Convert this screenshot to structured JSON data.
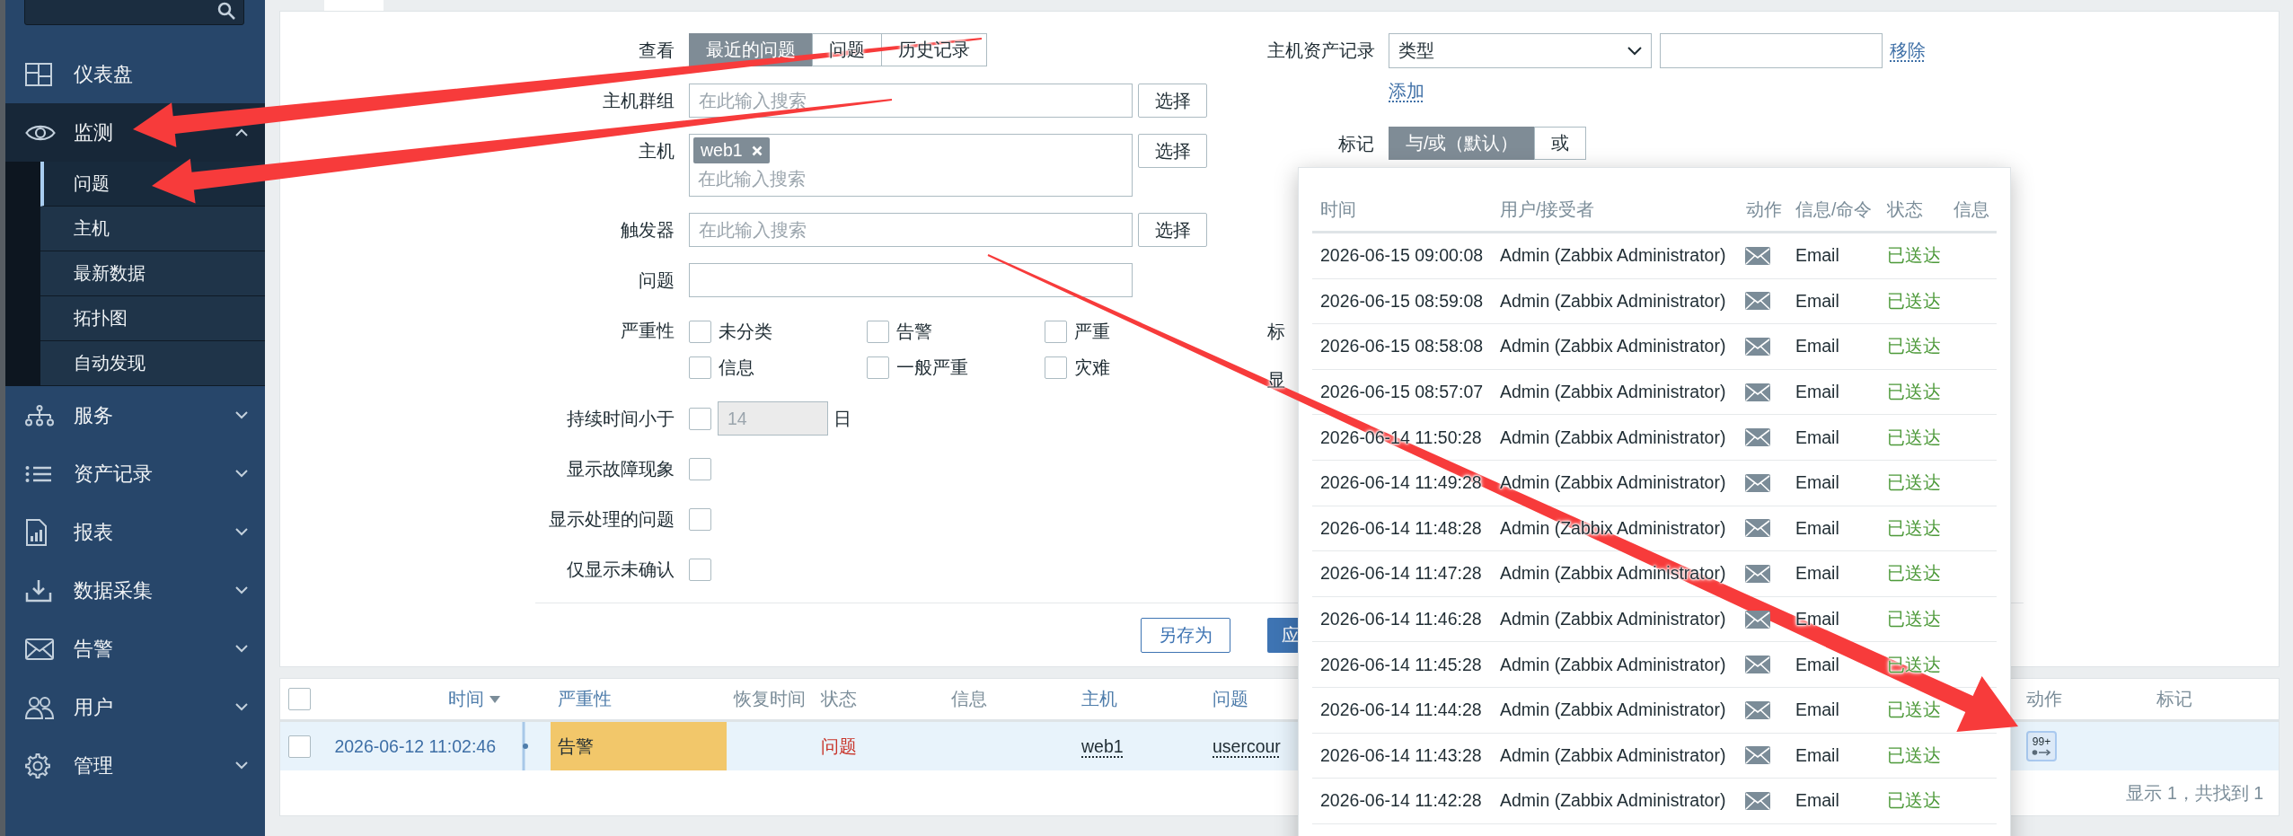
{
  "sidebar": {
    "items": [
      {
        "label": "仪表盘",
        "kind": "link"
      },
      {
        "label": "监测",
        "kind": "group",
        "expanded": true,
        "children": [
          {
            "label": "问题",
            "selected": true
          },
          {
            "label": "主机",
            "selected": false
          },
          {
            "label": "最新数据",
            "selected": false
          },
          {
            "label": "拓扑图",
            "selected": false
          },
          {
            "label": "自动发现",
            "selected": false
          }
        ]
      },
      {
        "label": "服务",
        "kind": "group",
        "expanded": false
      },
      {
        "label": "资产记录",
        "kind": "group",
        "expanded": false
      },
      {
        "label": "报表",
        "kind": "group",
        "expanded": false
      },
      {
        "label": "数据采集",
        "kind": "group",
        "expanded": false
      },
      {
        "label": "告警",
        "kind": "group",
        "expanded": false
      },
      {
        "label": "用户",
        "kind": "group",
        "expanded": false
      },
      {
        "label": "管理",
        "kind": "group",
        "expanded": false
      }
    ]
  },
  "filter": {
    "view": {
      "label": "查看",
      "options": [
        {
          "label": "最近的问题",
          "selected": true
        },
        {
          "label": "问题",
          "selected": false
        },
        {
          "label": "历史记录",
          "selected": false
        }
      ]
    },
    "host_groups": {
      "label": "主机群组",
      "placeholder": "在此输入搜索",
      "button": "选择"
    },
    "hosts": {
      "label": "主机",
      "tags": [
        "web1"
      ],
      "placeholder": "在此输入搜索",
      "button": "选择"
    },
    "triggers": {
      "label": "触发器",
      "placeholder": "在此输入搜索",
      "button": "选择"
    },
    "problem": {
      "label": "问题"
    },
    "severity": {
      "label": "严重性",
      "options": [
        {
          "label": "未分类",
          "checked": false
        },
        {
          "label": "告警",
          "checked": false
        },
        {
          "label": "严重",
          "checked": false
        },
        {
          "label": "信息",
          "checked": false
        },
        {
          "label": "一般严重",
          "checked": false
        },
        {
          "label": "灾难",
          "checked": false
        }
      ]
    },
    "age": {
      "label": "持续时间小于",
      "checked": false,
      "value": "14",
      "disabled": true,
      "unit": "日"
    },
    "options": [
      {
        "label": "显示故障现象",
        "checked": false
      },
      {
        "label": "显示处理的问题",
        "checked": false
      },
      {
        "label": "仅显示未确认",
        "checked": false
      }
    ],
    "inventory": {
      "label": "主机资产记录",
      "field": "类型",
      "remove": "移除",
      "add": "添加"
    },
    "tags": {
      "label": "标记",
      "options": [
        {
          "label": "与/或（默认）",
          "selected": true
        },
        {
          "label": "或",
          "selected": false
        }
      ]
    },
    "covered_labels": [
      "标",
      "显"
    ],
    "buttons": [
      {
        "label": "另存为",
        "kind": "secondary"
      },
      {
        "label": "应",
        "kind": "primary"
      }
    ]
  },
  "problems": {
    "all_checked": false,
    "columns": [
      {
        "label": "时间",
        "sortable": true,
        "sorted": true
      },
      {
        "label": "严重性",
        "sortable": true,
        "sorted": false
      },
      {
        "label": "恢复时间",
        "sortable": false,
        "sorted": false
      },
      {
        "label": "状态",
        "sortable": false,
        "sorted": false
      },
      {
        "label": "信息",
        "sortable": false,
        "sorted": false
      },
      {
        "label": "主机",
        "sortable": true,
        "sorted": false
      },
      {
        "label": "问题",
        "sortable": true,
        "sorted": false
      },
      {
        "label": "动作",
        "sortable": false,
        "sorted": false
      },
      {
        "label": "标记",
        "sortable": false,
        "sorted": false
      }
    ],
    "rows": [
      {
        "checked": false,
        "time": "2026-06-12 11:02:46",
        "severity": "告警",
        "color": "#f2c76a",
        "status": "问题",
        "host": "web1",
        "problem": "usercour",
        "actions": "99+"
      }
    ],
    "summary": "显示 1，共找到 1"
  },
  "action_popup": {
    "columns": [
      "时间",
      "用户/接受者",
      "动作",
      "信息/命令",
      "状态",
      "信息"
    ],
    "rows": [
      {
        "time": "2026-06-15 09:00:08",
        "user": "Admin (Zabbix Administrator)",
        "message": "Email",
        "status": "已送达"
      },
      {
        "time": "2026-06-15 08:59:08",
        "user": "Admin (Zabbix Administrator)",
        "message": "Email",
        "status": "已送达"
      },
      {
        "time": "2026-06-15 08:58:08",
        "user": "Admin (Zabbix Administrator)",
        "message": "Email",
        "status": "已送达"
      },
      {
        "time": "2026-06-15 08:57:07",
        "user": "Admin (Zabbix Administrator)",
        "message": "Email",
        "status": "已送达"
      },
      {
        "time": "2026-06-14 11:50:28",
        "user": "Admin (Zabbix Administrator)",
        "message": "Email",
        "status": "已送达"
      },
      {
        "time": "2026-06-14 11:49:28",
        "user": "Admin (Zabbix Administrator)",
        "message": "Email",
        "status": "已送达"
      },
      {
        "time": "2026-06-14 11:48:28",
        "user": "Admin (Zabbix Administrator)",
        "message": "Email",
        "status": "已送达"
      },
      {
        "time": "2026-06-14 11:47:28",
        "user": "Admin (Zabbix Administrator)",
        "message": "Email",
        "status": "已送达"
      },
      {
        "time": "2026-06-14 11:46:28",
        "user": "Admin (Zabbix Administrator)",
        "message": "Email",
        "status": "已送达"
      },
      {
        "time": "2026-06-14 11:45:28",
        "user": "Admin (Zabbix Administrator)",
        "message": "Email",
        "status": "已送达"
      },
      {
        "time": "2026-06-14 11:44:28",
        "user": "Admin (Zabbix Administrator)",
        "message": "Email",
        "status": "已送达"
      },
      {
        "time": "2026-06-14 11:43:28",
        "user": "Admin (Zabbix Administrator)",
        "message": "Email",
        "status": "已送达"
      },
      {
        "time": "2026-06-14 11:42:28",
        "user": "Admin (Zabbix Administrator)",
        "message": "Email",
        "status": "已送达"
      }
    ]
  }
}
